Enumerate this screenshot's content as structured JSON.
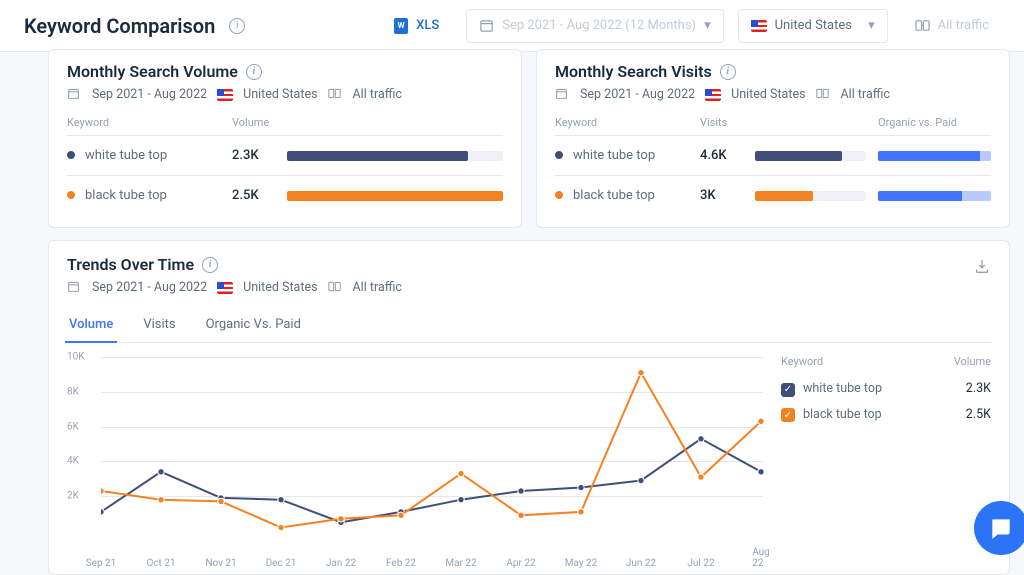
{
  "header": {
    "title": "Keyword Comparison",
    "xls_label": "XLS",
    "dateRange": "Sep 2021 - Aug 2022 (12 Months)",
    "country": "United States",
    "traffic": "All traffic"
  },
  "cards": {
    "volumeCard": {
      "title": "Monthly Search Volume",
      "dateRange": "Sep 2021 - Aug 2022",
      "country": "United States",
      "traffic": "All traffic",
      "headers": {
        "keyword": "Keyword",
        "volume": "Volume"
      },
      "rows": [
        {
          "series": "a",
          "keyword": "white tube top",
          "value": "2.3K",
          "pct": 0.84
        },
        {
          "series": "b",
          "keyword": "black tube top",
          "value": "2.5K",
          "pct": 1.0
        }
      ]
    },
    "visitsCard": {
      "title": "Monthly Search Visits",
      "dateRange": "Sep 2021 - Aug 2022",
      "country": "United States",
      "traffic": "All traffic",
      "headers": {
        "keyword": "Keyword",
        "visits": "Visits",
        "ovp": "Organic vs. Paid"
      },
      "rows": [
        {
          "series": "a",
          "keyword": "white tube top",
          "value": "4.6K",
          "pct": 0.78,
          "organic": 0.9
        },
        {
          "series": "b",
          "keyword": "black tube top",
          "value": "3K",
          "pct": 0.52,
          "organic": 0.74
        }
      ]
    }
  },
  "trends": {
    "title": "Trends Over Time",
    "dateRange": "Sep 2021 - Aug 2022",
    "country": "United States",
    "traffic": "All traffic",
    "tabs": [
      "Volume",
      "Visits",
      "Organic Vs. Paid"
    ],
    "activeTab": 0,
    "legend": {
      "headers": {
        "keyword": "Keyword",
        "volume": "Volume"
      },
      "rows": [
        {
          "series": "a",
          "name": "white tube top",
          "value": "2.3K"
        },
        {
          "series": "b",
          "name": "black tube top",
          "value": "2.5K"
        }
      ]
    }
  },
  "chart_data": {
    "type": "line",
    "title": "Trends Over Time — Volume",
    "xlabel": "",
    "ylabel": "",
    "ylim": [
      0,
      10000
    ],
    "yticks": [
      2000,
      4000,
      6000,
      8000,
      10000
    ],
    "ytick_labels": [
      "2K",
      "4K",
      "6K",
      "8K",
      "10K"
    ],
    "categories": [
      "Sep 21",
      "Oct 21",
      "Nov 21",
      "Dec 21",
      "Jan 22",
      "Feb 22",
      "Mar 22",
      "Apr 22",
      "May 22",
      "Jun 22",
      "Jul 22",
      "Aug 22"
    ],
    "series": [
      {
        "name": "white tube top",
        "color": "#3f4f7a",
        "values": [
          1100,
          3400,
          1900,
          1800,
          500,
          1100,
          1800,
          2300,
          2500,
          2900,
          5300,
          3400
        ]
      },
      {
        "name": "black tube top",
        "color": "#f58220",
        "values": [
          2300,
          1800,
          1700,
          200,
          700,
          900,
          3300,
          900,
          1100,
          9100,
          3100,
          6300
        ]
      }
    ]
  }
}
